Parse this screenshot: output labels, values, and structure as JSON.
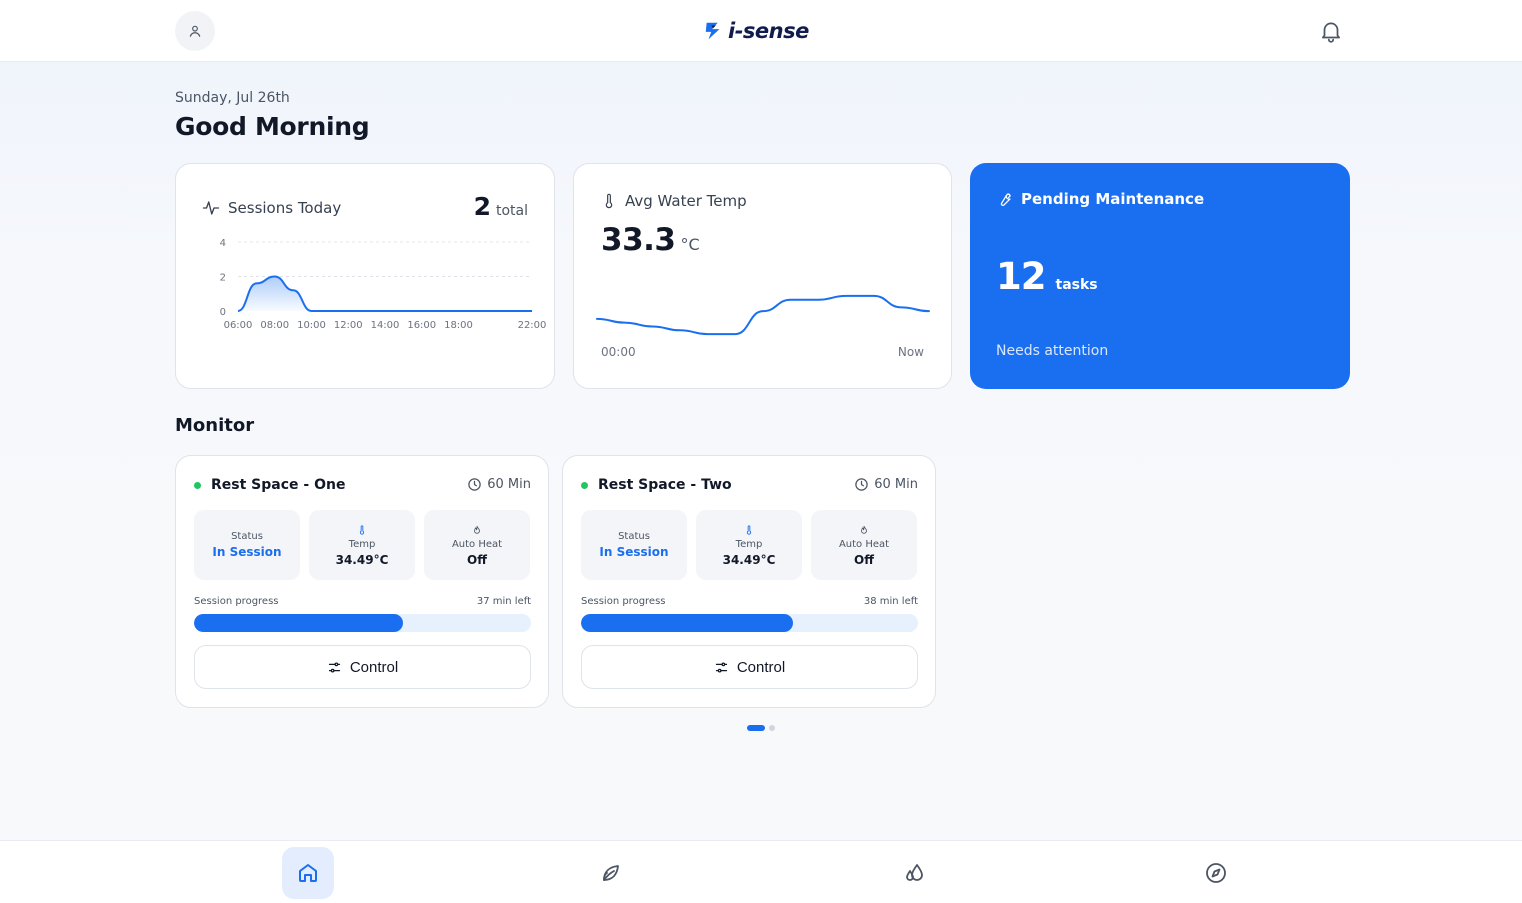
{
  "header": {
    "brand": "i-sense",
    "avatar_icon": "user-icon",
    "notification_icon": "bell-icon"
  },
  "greeting": {
    "date": "Sunday, Jul 26th",
    "title": "Good Morning"
  },
  "sessions_card": {
    "title": "Sessions Today",
    "total_value": "2",
    "total_unit": "total",
    "icon": "activity-icon"
  },
  "temp_card": {
    "title": "Avg Water Temp",
    "value": "33.3",
    "unit": "°C",
    "axis_start": "00:00",
    "axis_end": "Now",
    "icon": "thermometer-icon"
  },
  "maintenance_card": {
    "title": "Pending Maintenance",
    "count": "12",
    "unit": "tasks",
    "note": "Needs attention",
    "icon": "wrench-icon"
  },
  "monitor": {
    "title": "Monitor",
    "cards": [
      {
        "name": "Rest Space - One",
        "duration": "60 Min",
        "status_label": "Status",
        "status_value": "In Session",
        "temp_label": "Temp",
        "temp_value": "34.49°C",
        "heat_label": "Auto Heat",
        "heat_value": "Off",
        "progress_label": "Session progress",
        "time_left": "37 min left",
        "progress": 0.62,
        "control_label": "Control"
      },
      {
        "name": "Rest Space - Two",
        "duration": "60 Min",
        "status_label": "Status",
        "status_value": "In Session",
        "temp_label": "Temp",
        "temp_value": "34.49°C",
        "heat_label": "Auto Heat",
        "heat_value": "Off",
        "progress_label": "Session progress",
        "time_left": "38 min left",
        "progress": 0.63,
        "control_label": "Control"
      }
    ],
    "pager": {
      "pages": 2,
      "current": 1
    }
  },
  "bottom_nav": {
    "items": [
      {
        "icon": "home-icon",
        "active": true
      },
      {
        "icon": "leaf-icon",
        "active": false
      },
      {
        "icon": "droplets-icon",
        "active": false
      },
      {
        "icon": "compass-icon",
        "active": false
      }
    ]
  },
  "colors": {
    "accent": "#1a6ff0",
    "status_active": "#22c55e"
  },
  "chart_data": [
    {
      "type": "area",
      "categories": [
        "06:00",
        "08:00",
        "10:00",
        "12:00",
        "14:00",
        "16:00",
        "18:00",
        "22:00"
      ],
      "yticks": [
        "4",
        "2",
        "0"
      ],
      "ylim": [
        0,
        4
      ],
      "x": [
        6,
        7,
        8,
        9,
        10,
        12,
        14,
        16,
        18,
        20,
        22
      ],
      "values": [
        0,
        1.6,
        2,
        1.2,
        0,
        0,
        0,
        0,
        0,
        0,
        0
      ],
      "grid": true
    },
    {
      "type": "line",
      "xlabels": [
        "00:00",
        "Now"
      ],
      "values": [
        33.0,
        32.9,
        32.8,
        32.7,
        32.6,
        32.6,
        33.2,
        33.5,
        33.5,
        33.6,
        33.6,
        33.3,
        33.2
      ],
      "grid": false
    }
  ]
}
